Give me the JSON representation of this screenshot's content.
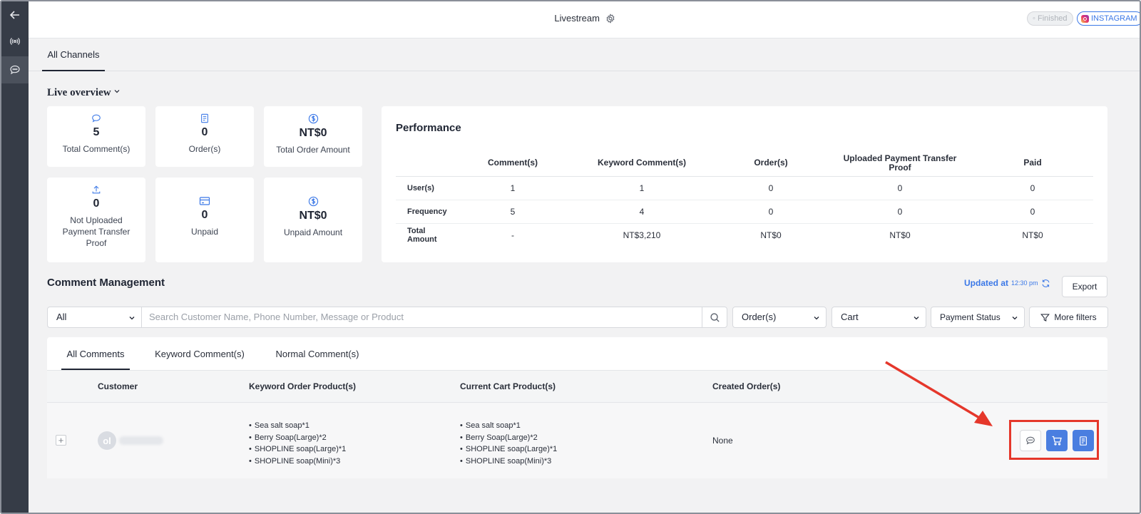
{
  "topbar": {
    "title": "Livestream",
    "status_badge": "Finished",
    "platform_badge": "INSTAGRAM"
  },
  "channels": {
    "active_tab": "All Channels"
  },
  "overview": {
    "heading": "Live overview",
    "stats": [
      {
        "icon": "comment-icon",
        "value": "5",
        "label": "Total Comment(s)"
      },
      {
        "icon": "order-icon",
        "value": "0",
        "label": "Order(s)"
      },
      {
        "icon": "dollar-icon",
        "value": "NT$0",
        "label": "Total Order Amount"
      },
      {
        "icon": "upload-icon",
        "value": "0",
        "label": "Not Uploaded Payment Transfer Proof"
      },
      {
        "icon": "card-icon",
        "value": "0",
        "label": "Unpaid"
      },
      {
        "icon": "dollar-icon",
        "value": "NT$0",
        "label": "Unpaid Amount"
      }
    ]
  },
  "performance": {
    "title": "Performance",
    "columns": [
      "",
      "Comment(s)",
      "Keyword Comment(s)",
      "Order(s)",
      "Uploaded Payment Transfer Proof",
      "Paid"
    ],
    "rows": [
      {
        "label": "User(s)",
        "values": [
          "1",
          "1",
          "0",
          "0",
          "0"
        ]
      },
      {
        "label": "Frequency",
        "values": [
          "5",
          "4",
          "0",
          "0",
          "0"
        ]
      },
      {
        "label": "Total Amount",
        "values": [
          "-",
          "NT$3,210",
          "NT$0",
          "NT$0",
          "NT$0"
        ]
      }
    ]
  },
  "comment_management": {
    "title": "Comment Management",
    "updated_label": "Updated at",
    "updated_time": "12:30 pm",
    "export_label": "Export",
    "filter_scope": "All",
    "search_placeholder": "Search Customer Name, Phone Number, Message or Product",
    "orders_select": "Order(s)",
    "cart_select": "Cart",
    "payment_select": "Payment Status",
    "more_filters": "More filters",
    "tabs": [
      "All Comments",
      "Keyword Comment(s)",
      "Normal Comment(s)"
    ],
    "columns": [
      "Customer",
      "Keyword Order Product(s)",
      "Current Cart Product(s)",
      "Created Order(s)"
    ],
    "rows": [
      {
        "avatar_initials": "ol",
        "keyword_products": [
          "Sea salt soap*1",
          "Berry Soap(Large)*2",
          "SHOPLINE soap(Large)*1",
          "SHOPLINE soap(Mini)*3"
        ],
        "cart_products": [
          "Sea salt soap*1",
          "Berry Soap(Large)*2",
          "SHOPLINE soap(Large)*1",
          "SHOPLINE soap(Mini)*3"
        ],
        "created_orders": "None"
      }
    ]
  },
  "colors": {
    "accent": "#3b78e7",
    "action_blue": "#4a7ee0",
    "highlight": "#e5372b",
    "rail": "#363c47"
  }
}
